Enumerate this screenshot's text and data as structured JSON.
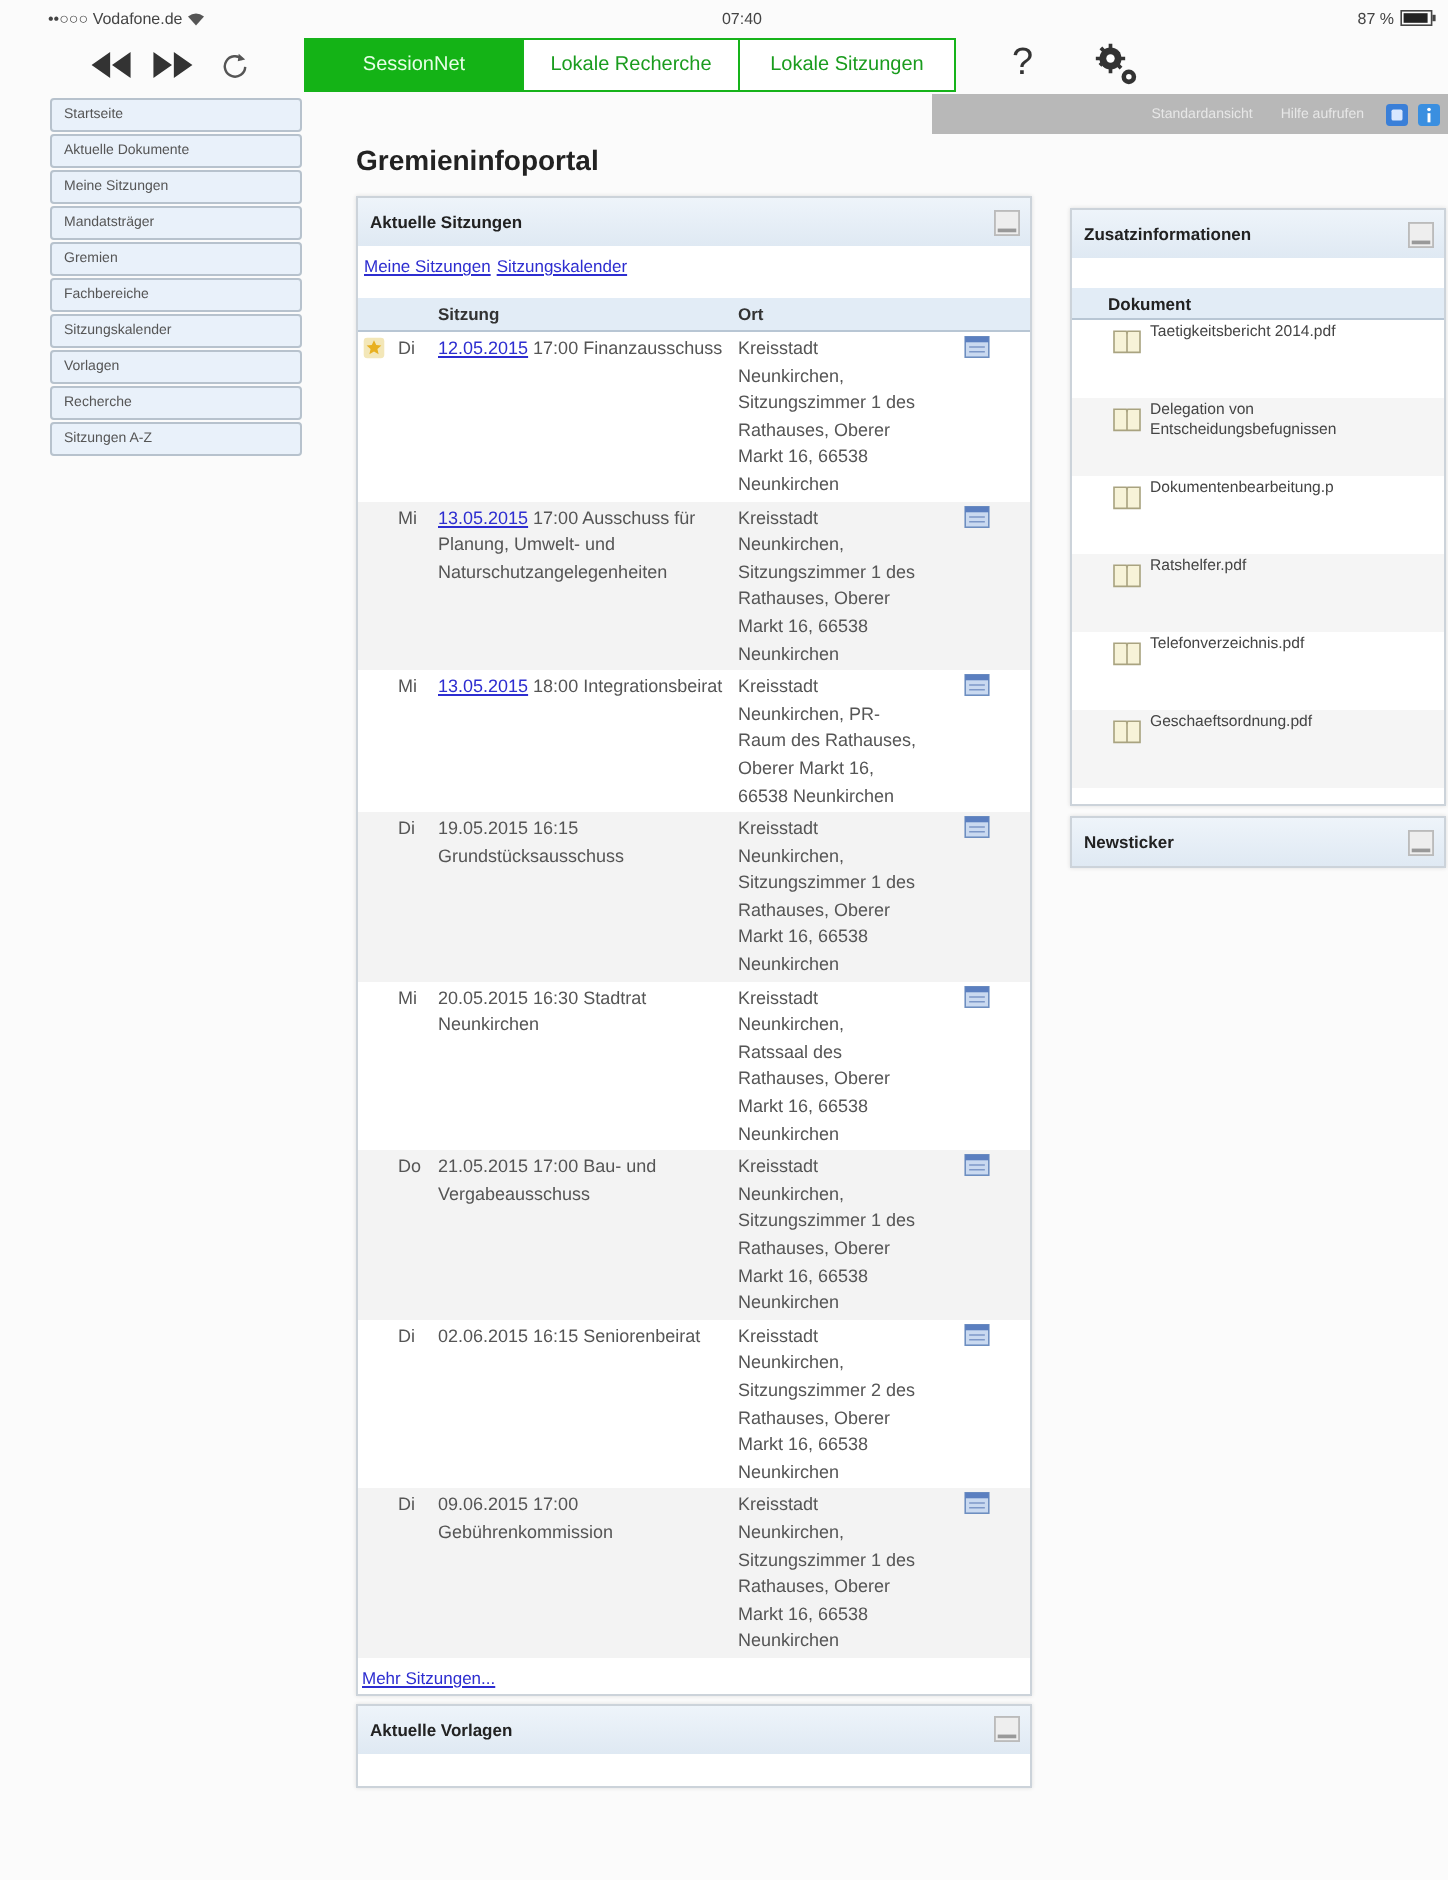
{
  "status_bar": {
    "carrier": "••○○○ Vodafone.de",
    "time": "07:40",
    "battery": "87 %"
  },
  "tabs": [
    {
      "label": "SessionNet",
      "selected": true
    },
    {
      "label": "Lokale Recherche",
      "selected": false
    },
    {
      "label": "Lokale Sitzungen",
      "selected": false
    }
  ],
  "help_button": "?",
  "sidebar": {
    "items": [
      "Startseite",
      "Aktuelle Dokumente",
      "Meine Sitzungen",
      "Mandatsträger",
      "Gremien",
      "Fachbereiche",
      "Sitzungskalender",
      "Vorlagen",
      "Recherche",
      "Sitzungen A-Z"
    ]
  },
  "view_bar": {
    "items": [
      "Standardansicht",
      "Hilfe aufrufen"
    ]
  },
  "page_title": "Gremieninfoportal",
  "sessions_panel": {
    "title": "Aktuelle Sitzungen",
    "links": [
      "Meine Sitzungen",
      "Sitzungskalender"
    ],
    "columns": [
      "Sitzung",
      "Ort"
    ],
    "rows": [
      {
        "starred": true,
        "day": "Di",
        "date": "12.05.2015",
        "linked": true,
        "time": "17:00",
        "name": "Finanzausschuss",
        "place": "Kreisstadt Neunkirchen, Sitzungszimmer 1 des Rathauses, Oberer Markt 16, 66538 Neunkirchen"
      },
      {
        "starred": false,
        "day": "Mi",
        "date": "13.05.2015",
        "linked": true,
        "time": "17:00",
        "name": "Ausschuss für Planung, Umwelt- und Naturschutzangelegenheiten",
        "place": "Kreisstadt Neunkirchen, Sitzungszimmer 1 des Rathauses, Oberer Markt 16, 66538 Neunkirchen"
      },
      {
        "starred": false,
        "day": "Mi",
        "date": "13.05.2015",
        "linked": true,
        "time": "18:00",
        "name": "Integrationsbeirat",
        "place": "Kreisstadt Neunkirchen, PR-Raum des Rathauses, Oberer Markt 16, 66538 Neunkirchen"
      },
      {
        "starred": false,
        "day": "Di",
        "date": "19.05.2015",
        "linked": false,
        "time": "16:15",
        "name": "Grundstücksausschuss",
        "place": "Kreisstadt Neunkirchen, Sitzungszimmer 1 des Rathauses, Oberer Markt 16, 66538 Neunkirchen"
      },
      {
        "starred": false,
        "day": "Mi",
        "date": "20.05.2015",
        "linked": false,
        "time": "16:30",
        "name": "Stadtrat Neunkirchen",
        "place": "Kreisstadt Neunkirchen, Ratssaal des Rathauses, Oberer Markt 16, 66538 Neunkirchen"
      },
      {
        "starred": false,
        "day": "Do",
        "date": "21.05.2015",
        "linked": false,
        "time": "17:00",
        "name": "Bau- und Vergabeausschuss",
        "place": "Kreisstadt Neunkirchen, Sitzungszimmer 1 des Rathauses, Oberer Markt 16, 66538 Neunkirchen"
      },
      {
        "starred": false,
        "day": "Di",
        "date": "02.06.2015",
        "linked": false,
        "time": "16:15",
        "name": "Seniorenbeirat",
        "place": "Kreisstadt Neunkirchen, Sitzungszimmer 2 des Rathauses, Oberer Markt 16, 66538 Neunkirchen"
      },
      {
        "starred": false,
        "day": "Di",
        "date": "09.06.2015",
        "linked": false,
        "time": "17:00",
        "name": "Gebührenkommission",
        "place": "Kreisstadt Neunkirchen, Sitzungszimmer 1 des Rathauses, Oberer Markt 16, 66538 Neunkirchen"
      }
    ],
    "more_link": "Mehr Sitzungen..."
  },
  "templates_panel": {
    "title": "Aktuelle Vorlagen"
  },
  "info_panel": {
    "title": "Zusatzinformationen",
    "column": "Dokument",
    "documents": [
      "Taetigkeitsbericht 2014.pdf",
      "Delegation von Entscheidungsbefugnissen",
      "Dokumentenbearbeitung.p",
      "Ratshelfer.pdf",
      "Telefonverzeichnis.pdf",
      "Geschaeftsordnung.pdf"
    ]
  },
  "news_panel": {
    "title": "Newsticker"
  }
}
